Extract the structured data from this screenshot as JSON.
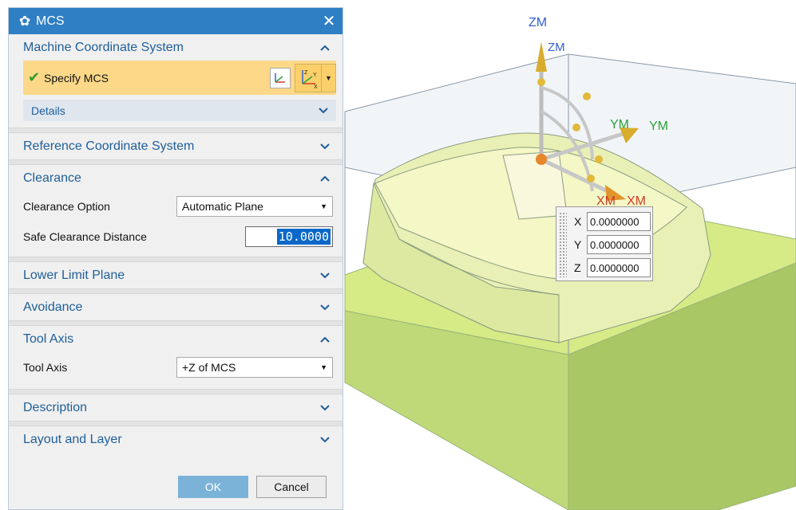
{
  "dialog": {
    "title": "MCS",
    "sections": {
      "machine_cs": {
        "label": "Machine Coordinate System",
        "specify_label": "Specify MCS",
        "details_label": "Details"
      },
      "reference_cs": {
        "label": "Reference Coordinate System"
      },
      "clearance": {
        "label": "Clearance",
        "option_label": "Clearance Option",
        "option_value": "Automatic Plane",
        "distance_label": "Safe Clearance Distance",
        "distance_value": "10.0000"
      },
      "lower_limit": {
        "label": "Lower Limit Plane"
      },
      "avoidance": {
        "label": "Avoidance"
      },
      "tool_axis": {
        "label": "Tool Axis",
        "field_label": "Tool Axis",
        "field_value": "+Z of MCS"
      },
      "description": {
        "label": "Description"
      },
      "layout_layer": {
        "label": "Layout and Layer"
      }
    },
    "buttons": {
      "ok": "OK",
      "cancel": "Cancel"
    }
  },
  "viewport": {
    "axes": {
      "zm_outer": "ZM",
      "zm_inner": "ZM",
      "ym_1": "YM",
      "ym_2": "YM",
      "xm_1": "XM",
      "xm_2": "XM"
    },
    "coords": {
      "x_label": "X",
      "x_value": "0.0000000",
      "y_label": "Y",
      "y_value": "0.0000000",
      "z_label": "Z",
      "z_value": "0.0000000"
    }
  },
  "colors": {
    "title_bar": "#2f7fc5",
    "section_text": "#1f5e99",
    "highlight": "#fcd888",
    "part_green": "#cfe48a",
    "stock_blue": "#dbe4ee"
  }
}
